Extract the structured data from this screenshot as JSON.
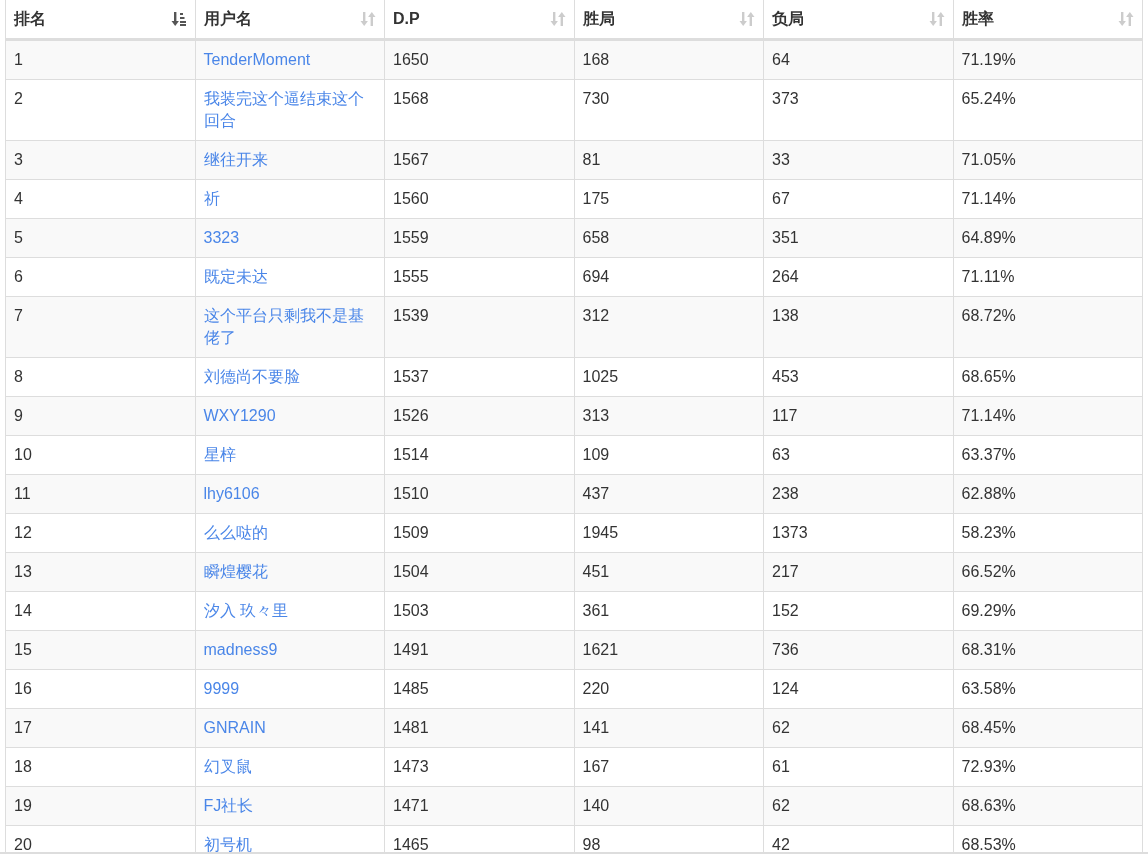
{
  "table": {
    "columns": [
      {
        "label": "排名",
        "sorted": true
      },
      {
        "label": "用户名",
        "sorted": false
      },
      {
        "label": "D.P",
        "sorted": false
      },
      {
        "label": "胜局",
        "sorted": false
      },
      {
        "label": "负局",
        "sorted": false
      },
      {
        "label": "胜率",
        "sorted": false
      }
    ],
    "rows": [
      {
        "rank": "1",
        "user": "TenderMoment",
        "dp": "1650",
        "wins": "168",
        "losses": "64",
        "rate": "71.19%"
      },
      {
        "rank": "2",
        "user": "我装完这个逼结束这个回合",
        "dp": "1568",
        "wins": "730",
        "losses": "373",
        "rate": "65.24%"
      },
      {
        "rank": "3",
        "user": "继往开来",
        "dp": "1567",
        "wins": "81",
        "losses": "33",
        "rate": "71.05%"
      },
      {
        "rank": "4",
        "user": "祈",
        "dp": "1560",
        "wins": "175",
        "losses": "67",
        "rate": "71.14%"
      },
      {
        "rank": "5",
        "user": "3323",
        "dp": "1559",
        "wins": "658",
        "losses": "351",
        "rate": "64.89%"
      },
      {
        "rank": "6",
        "user": "既定未达",
        "dp": "1555",
        "wins": "694",
        "losses": "264",
        "rate": "71.11%"
      },
      {
        "rank": "7",
        "user": "这个平台只剩我不是基佬了",
        "dp": "1539",
        "wins": "312",
        "losses": "138",
        "rate": "68.72%"
      },
      {
        "rank": "8",
        "user": "刘德尚不要脸",
        "dp": "1537",
        "wins": "1025",
        "losses": "453",
        "rate": "68.65%"
      },
      {
        "rank": "9",
        "user": "WXY1290",
        "dp": "1526",
        "wins": "313",
        "losses": "117",
        "rate": "71.14%"
      },
      {
        "rank": "10",
        "user": "星梓",
        "dp": "1514",
        "wins": "109",
        "losses": "63",
        "rate": "63.37%"
      },
      {
        "rank": "11",
        "user": "lhy6106",
        "dp": "1510",
        "wins": "437",
        "losses": "238",
        "rate": "62.88%"
      },
      {
        "rank": "12",
        "user": "么么哒的",
        "dp": "1509",
        "wins": "1945",
        "losses": "1373",
        "rate": "58.23%"
      },
      {
        "rank": "13",
        "user": "瞬煌樱花",
        "dp": "1504",
        "wins": "451",
        "losses": "217",
        "rate": "66.52%"
      },
      {
        "rank": "14",
        "user": "汐入 玖々里",
        "dp": "1503",
        "wins": "361",
        "losses": "152",
        "rate": "69.29%"
      },
      {
        "rank": "15",
        "user": "madness9",
        "dp": "1491",
        "wins": "1621",
        "losses": "736",
        "rate": "68.31%"
      },
      {
        "rank": "16",
        "user": "9999",
        "dp": "1485",
        "wins": "220",
        "losses": "124",
        "rate": "63.58%"
      },
      {
        "rank": "17",
        "user": "GNRAIN",
        "dp": "1481",
        "wins": "141",
        "losses": "62",
        "rate": "68.45%"
      },
      {
        "rank": "18",
        "user": "幻叉鼠",
        "dp": "1473",
        "wins": "167",
        "losses": "61",
        "rate": "72.93%"
      },
      {
        "rank": "19",
        "user": "FJ社长",
        "dp": "1471",
        "wins": "140",
        "losses": "62",
        "rate": "68.63%"
      },
      {
        "rank": "20",
        "user": "初号机",
        "dp": "1465",
        "wins": "98",
        "losses": "42",
        "rate": "68.53%"
      }
    ]
  }
}
